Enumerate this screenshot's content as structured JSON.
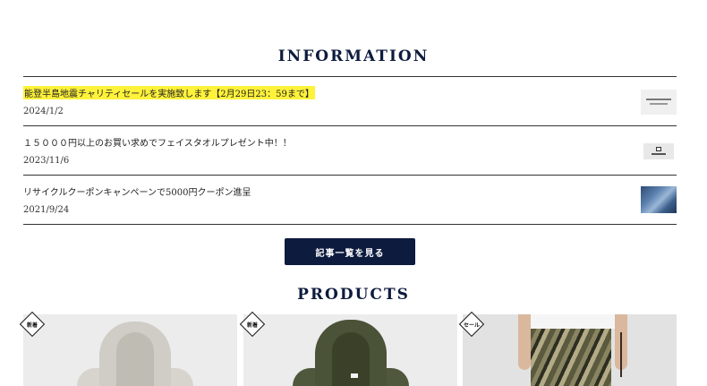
{
  "information": {
    "title": "INFORMATION",
    "items": [
      {
        "text": "能登半島地震チャリティセールを実施致します【2月29日23：59まで】",
        "date": "2024/1/2",
        "highlight_color": "#fff23a"
      },
      {
        "text": "１５０００円以上のお買い求めでフェイスタオルプレゼント中！！",
        "date": "2023/11/6"
      },
      {
        "text": "リサイクルクーポンキャンペーンで5000円クーポン進呈",
        "date": "2021/9/24"
      }
    ],
    "button_label": "記事一覧を見る"
  },
  "products": {
    "title": "PRODUCTS",
    "items": [
      {
        "badge": "新着",
        "image_icon": "grey-hoodie-image"
      },
      {
        "badge": "新着",
        "image_icon": "olive-hoodie-image"
      },
      {
        "badge": "セール",
        "image_icon": "camo-pants-image"
      }
    ]
  },
  "colors": {
    "navy": "#0d1b3e",
    "highlight": "#fff23a"
  }
}
